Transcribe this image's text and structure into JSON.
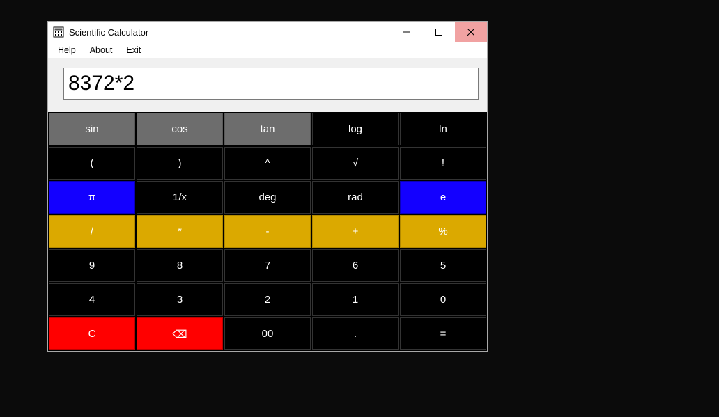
{
  "window": {
    "title": "Scientific Calculator"
  },
  "menu": {
    "help": "Help",
    "about": "About",
    "exit": "Exit"
  },
  "display": {
    "value": "8372*2"
  },
  "keys": {
    "r0": {
      "c0": "sin",
      "c1": "cos",
      "c2": "tan",
      "c3": "log",
      "c4": "ln"
    },
    "r1": {
      "c0": "(",
      "c1": ")",
      "c2": "^",
      "c3": "√",
      "c4": "!"
    },
    "r2": {
      "c0": "π",
      "c1": "1/x",
      "c2": "deg",
      "c3": "rad",
      "c4": "e"
    },
    "r3": {
      "c0": "/",
      "c1": "*",
      "c2": "-",
      "c3": "+",
      "c4": "%"
    },
    "r4": {
      "c0": "9",
      "c1": "8",
      "c2": "7",
      "c3": "6",
      "c4": "5"
    },
    "r5": {
      "c0": "4",
      "c1": "3",
      "c2": "2",
      "c3": "1",
      "c4": "0"
    },
    "r6": {
      "c0": "C",
      "c1": "⌫",
      "c2": "00",
      "c3": ".",
      "c4": "="
    }
  }
}
